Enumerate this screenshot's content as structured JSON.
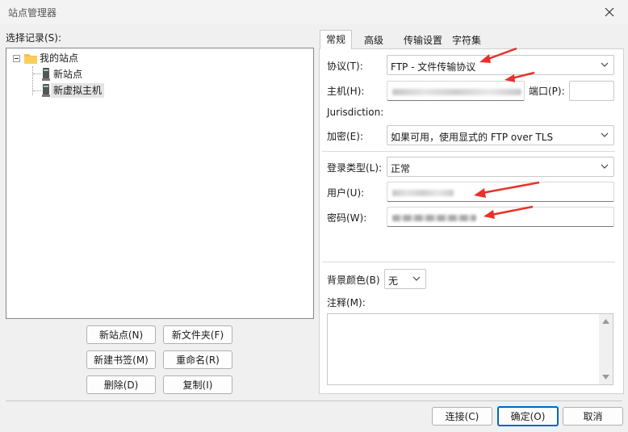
{
  "window": {
    "title": "站点管理器"
  },
  "left": {
    "select_label": "选择记录(S):",
    "tree": [
      {
        "label": "我的站点",
        "icon": "folder-icon"
      },
      {
        "label": "新站点",
        "icon": "server-icon"
      },
      {
        "label": "新虚拟主机",
        "icon": "server-icon",
        "selected": true
      }
    ],
    "buttons": {
      "new_site": "新站点(N)",
      "new_folder": "新文件夹(F)",
      "new_bookmark": "新建书签(M)",
      "rename": "重命名(R)",
      "delete": "删除(D)",
      "copy": "复制(I)"
    }
  },
  "tabs": [
    "常规",
    "高级",
    "传输设置",
    "字符集"
  ],
  "general": {
    "protocol_label": "协议(T):",
    "protocol_value": "FTP - 文件传输协议",
    "host_label": "主机(H):",
    "port_label": "端口(P):",
    "jurisdiction_label": "Jurisdiction:",
    "encryption_label": "加密(E):",
    "encryption_value": "如果可用，使用显式的 FTP over TLS",
    "logon_label": "登录类型(L):",
    "logon_value": "正常",
    "user_label": "用户(U):",
    "password_label": "密码(W):",
    "bg_label": "背景颜色(B)",
    "bg_value": "无",
    "notes_label": "注释(M):"
  },
  "footer": {
    "connect": "连接(C)",
    "ok": "确定(O)",
    "cancel": "取消"
  },
  "colors": {
    "accent": "#0067c0",
    "arrow": "#e8312a",
    "folder": "#f5c242"
  }
}
